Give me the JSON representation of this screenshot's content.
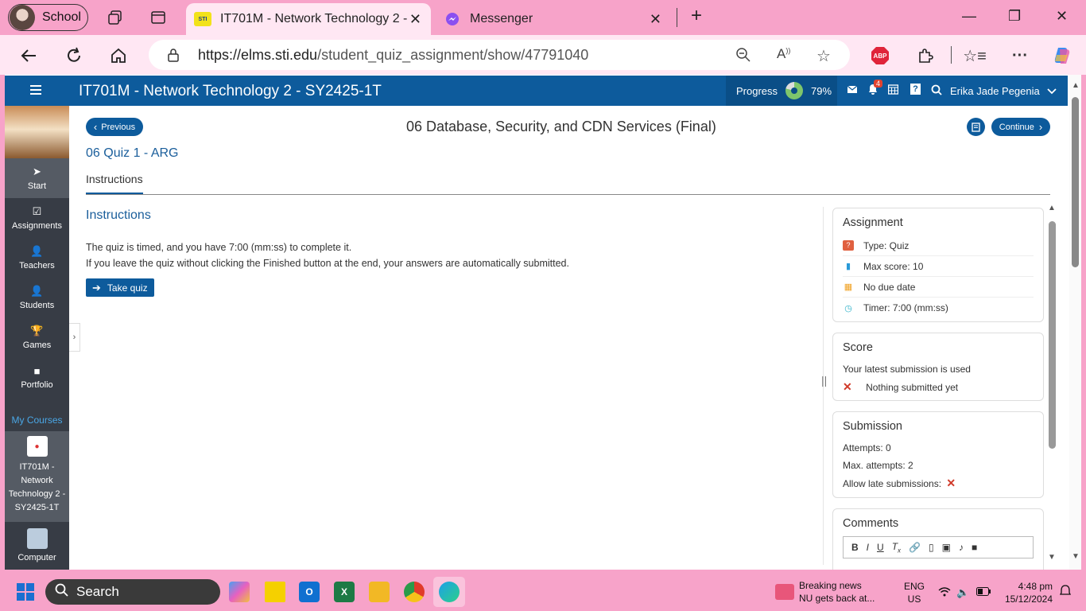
{
  "browser": {
    "profile_label": "School",
    "tabs": [
      {
        "title": "IT701M - Network Technology 2 -",
        "favicon": "STI",
        "active": true
      },
      {
        "title": "Messenger",
        "active": false
      }
    ],
    "url_host": "https://elms.sti.edu",
    "url_path": "/student_quiz_assignment/show/47791040"
  },
  "app": {
    "course_title": "IT701M - Network Technology 2 - SY2425-1T",
    "progress_label": "Progress",
    "progress_value": "79%",
    "progress_fraction": 0.79,
    "notification_count": "4",
    "user_name": "Erika Jade Pegenia"
  },
  "sidebar": {
    "items": [
      {
        "label": "Start",
        "icon": "navigate-icon"
      },
      {
        "label": "Assignments",
        "icon": "checkbox-icon"
      },
      {
        "label": "Teachers",
        "icon": "person-icon"
      },
      {
        "label": "Students",
        "icon": "person-icon"
      },
      {
        "label": "Games",
        "icon": "trophy-icon"
      },
      {
        "label": "Portfolio",
        "icon": "folder-icon"
      }
    ],
    "my_courses_label": "My Courses",
    "course_1": "IT701M - Network Technology 2 - SY2425-1T",
    "course_2": "Computer"
  },
  "main": {
    "previous_label": "Previous",
    "continue_label": "Continue",
    "section_title": "06 Database, Security, and CDN Services (Final)",
    "quiz_name": "06 Quiz 1 - ARG",
    "tab_label": "Instructions",
    "instructions_heading": "Instructions",
    "instruction_line_1": "The quiz is timed, and you have 7:00 (mm:ss) to complete it.",
    "instruction_line_2": "If you leave the quiz without clicking the Finished button at the end, your answers are automatically submitted.",
    "take_quiz_label": "Take quiz"
  },
  "assignment_card": {
    "title": "Assignment",
    "type": "Type: Quiz",
    "max_score": "Max score: 10",
    "due": "No due date",
    "timer": "Timer: 7:00 (mm:ss)"
  },
  "score_card": {
    "title": "Score",
    "note": "Your latest submission is used",
    "status": "Nothing submitted yet"
  },
  "submission_card": {
    "title": "Submission",
    "attempts": "Attempts: 0",
    "max_attempts": "Max. attempts: 2",
    "late": "Allow late submissions:"
  },
  "comments_card": {
    "title": "Comments"
  },
  "taskbar": {
    "search_label": "Search",
    "news_title": "Breaking news",
    "news_sub": "NU gets back at...",
    "lang_1": "ENG",
    "lang_2": "US",
    "time": "4:48 pm",
    "date": "15/12/2024"
  },
  "colors": {
    "brand_blue": "#0d5b9c",
    "browser_pink": "#f7a3c9",
    "sidebar_dark": "#373c45",
    "error_red": "#d03a2a"
  }
}
